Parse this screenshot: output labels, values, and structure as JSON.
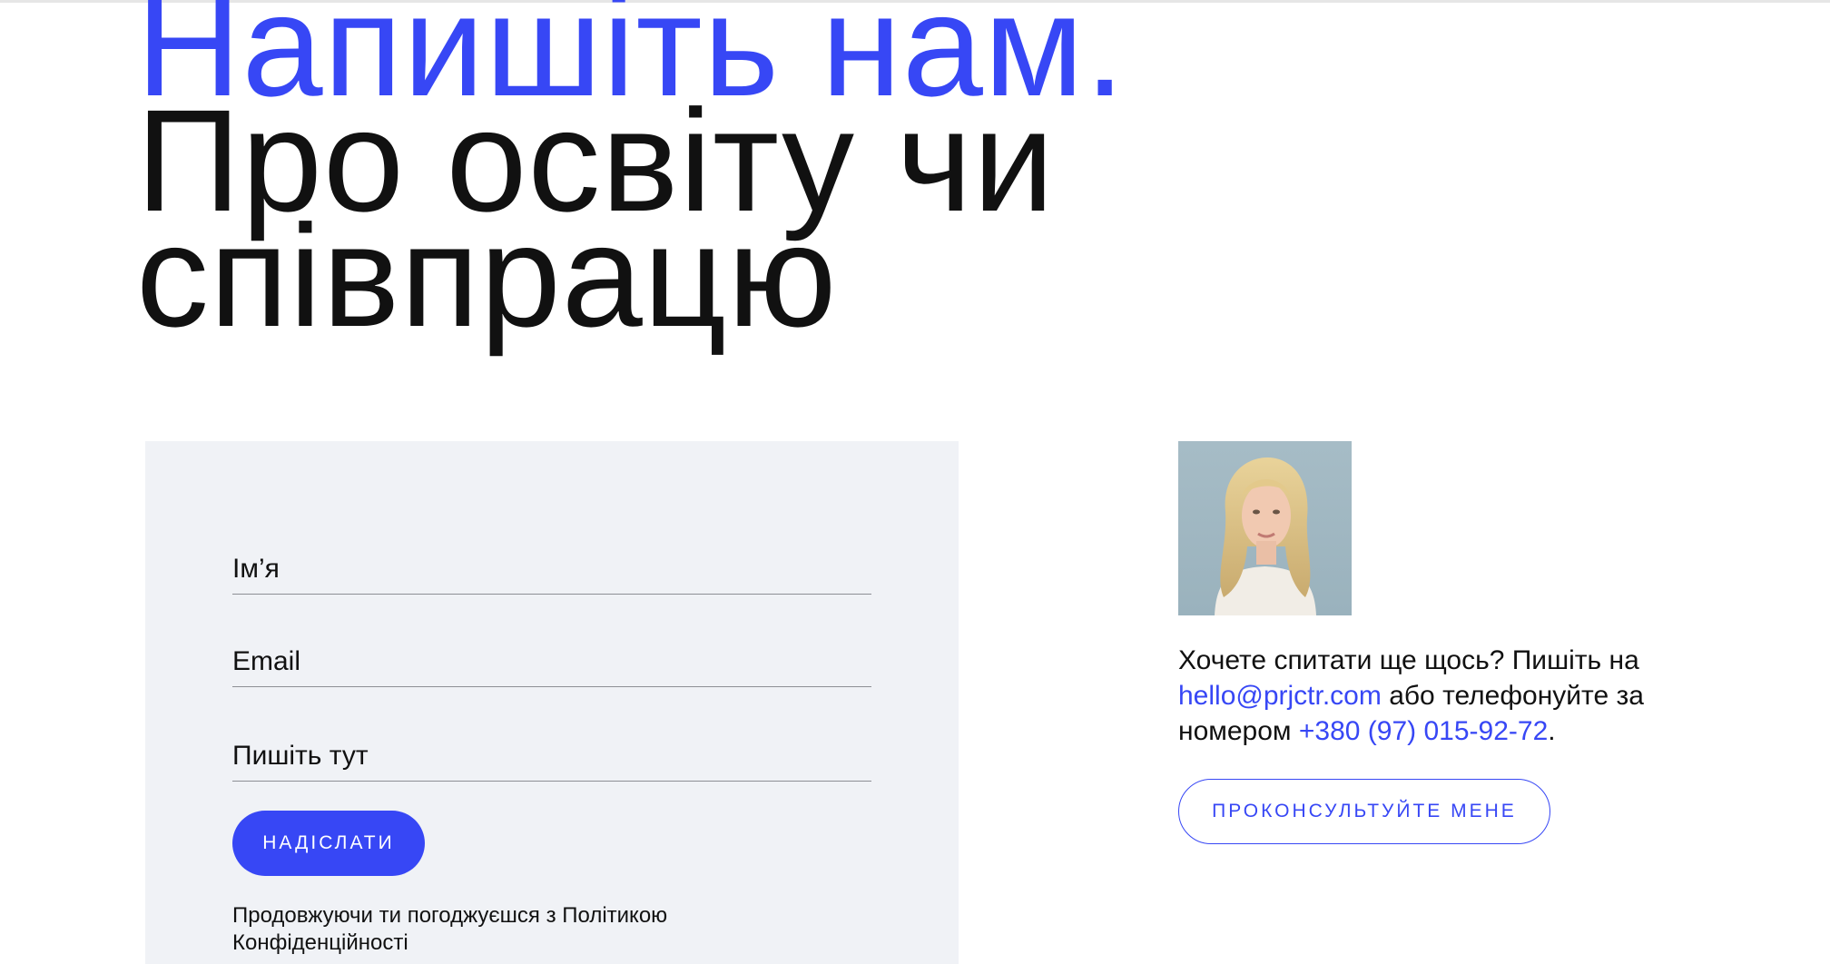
{
  "header": {
    "line1": "Напишіть нам.",
    "line2": "Про освіту чи",
    "line3": "співпрацю"
  },
  "form": {
    "name_placeholder": "Ім’я",
    "email_placeholder": "Email",
    "message_placeholder": "Пишіть тут",
    "submit_label": "НАДІСЛАТИ",
    "consent_text": "Продовжуючи ти погоджуєшся з ",
    "consent_link": "Політикою Конфіденційності"
  },
  "contact": {
    "photo_alt": "contact-person-photo",
    "text_before_email": "Хочете спитати ще щось? Пишіть на ",
    "email": "hello@prjctr.com",
    "text_before_phone": " або телефонуйте за номером ",
    "phone": "+380 (97) 015-92-72",
    "text_end": ".",
    "consult_label": "ПРОКОНСУЛЬТУЙТЕ МЕНЕ"
  },
  "colors": {
    "accent": "#3747f5",
    "text": "#111111",
    "panel_bg": "#f0f2f6",
    "underline": "#8d8f95"
  }
}
